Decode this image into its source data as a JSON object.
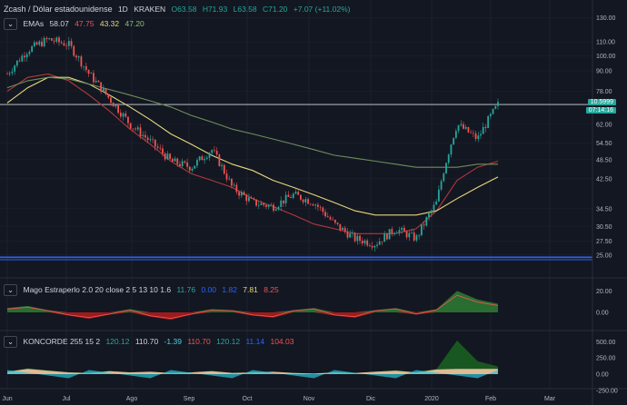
{
  "header": {
    "symbol": "Zcash / Dólar estadounidense",
    "interval": "1D",
    "exchange": "KRAKEN",
    "ohlc_open": "O63.58",
    "ohlc_high": "H71.93",
    "ohlc_low": "L63.58",
    "ohlc_close": "C71.20",
    "ohlc_change": "+7.07 (+11.02%)"
  },
  "ema_panel": {
    "label": "EMAs",
    "v1": "58.07",
    "v2": "47.75",
    "v3": "43.32",
    "v4": "47.20"
  },
  "mago_panel": {
    "label": "Mago Estraperlo 2.0 20 close 2 5 13 10 1.6",
    "v1": "11.76",
    "v2": "0.00",
    "v3": "1.82",
    "v4": "7.81",
    "v5": "8.25"
  },
  "koncorde_panel": {
    "label": "KONCORDE 255 15 2",
    "v1": "120.12",
    "v2": "110.70",
    "v3": "-1.39",
    "v4": "110.70",
    "v5": "120.12",
    "v6": "11.14",
    "v7": "104.03"
  },
  "price_label": {
    "last": "71.20",
    "prev": "10.5999",
    "countdown": "07:14:16"
  },
  "colors": {
    "up": "#26a69a",
    "down": "#ef5350",
    "bg": "#131722",
    "ema_red": "#b03a3a",
    "ema_yellow": "#e6d87a",
    "ema_green": "#6f8d5b",
    "blue_line": "#2962ff"
  },
  "chart_data": [
    {
      "type": "line",
      "title": "Zcash / Dólar estadounidense",
      "x": [
        "Jun",
        "Jul",
        "Ago",
        "Sep",
        "Oct",
        "Nov",
        "Dic",
        "2020",
        "Feb",
        "Mar"
      ],
      "price_axis_ticks": [
        "130.00",
        "110.00",
        "100.00",
        "90.00",
        "78.00",
        "62.00",
        "54.50",
        "48.50",
        "42.50",
        "34.50",
        "30.50",
        "27.50",
        "25.00"
      ],
      "yscale": "log",
      "series": [
        {
          "role": "price",
          "values": [
            88,
            104,
            112,
            108,
            88,
            74,
            62,
            55,
            48,
            46,
            52,
            40,
            36,
            35,
            38,
            36,
            31,
            28,
            27,
            30,
            28,
            36,
            62,
            56,
            71
          ]
        },
        {
          "role": "ema-red",
          "values": [
            78,
            86,
            88,
            84,
            76,
            68,
            60,
            54,
            48,
            44,
            42,
            40,
            37,
            35,
            33,
            31,
            30,
            29,
            29,
            29,
            30,
            34,
            42,
            46,
            48
          ]
        },
        {
          "role": "ema-yellow",
          "values": [
            72,
            80,
            86,
            86,
            82,
            76,
            70,
            64,
            58,
            54,
            50,
            47,
            45,
            42,
            40,
            38,
            36,
            34,
            33,
            33,
            33,
            34,
            37,
            40,
            43
          ]
        },
        {
          "role": "ema-green",
          "values": [
            80,
            84,
            86,
            85,
            82,
            79,
            76,
            73,
            70,
            66,
            63,
            60,
            58,
            56,
            54,
            52,
            50,
            49,
            48,
            47,
            46,
            46,
            46,
            47,
            47
          ]
        }
      ]
    },
    {
      "type": "area",
      "title": "Mago Estraperlo",
      "y_ticks": [
        "20.00",
        "0.00"
      ],
      "values": [
        4,
        6,
        2,
        -3,
        -6,
        -2,
        3,
        -4,
        -7,
        -2,
        3,
        2,
        -3,
        -5,
        2,
        4,
        -3,
        -5,
        2,
        4,
        -2,
        3,
        20,
        12,
        8
      ]
    },
    {
      "type": "area",
      "title": "KONCORDE",
      "y_ticks": [
        "500.00",
        "250.00",
        "0.00",
        "-250.00"
      ],
      "values": [
        40,
        90,
        60,
        30,
        20,
        50,
        30,
        40,
        20,
        30,
        50,
        20,
        30,
        40,
        20,
        10,
        30,
        20,
        40,
        60,
        30,
        80,
        520,
        200,
        120
      ]
    }
  ]
}
